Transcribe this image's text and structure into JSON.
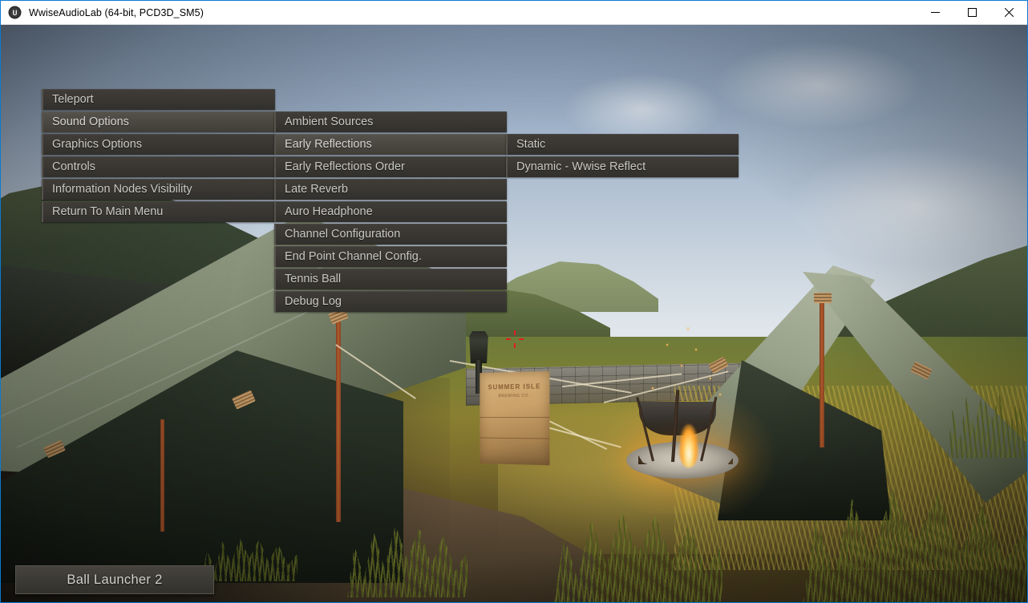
{
  "window": {
    "title": "WwiseAudioLab (64-bit, PCD3D_SM5)",
    "icon": "unreal-engine-icon",
    "controls": {
      "minimize": "minimize-icon",
      "maximize": "maximize-icon",
      "close": "close-icon"
    },
    "accent_border": "#0a7ad0"
  },
  "menus": {
    "column1": {
      "items": [
        {
          "label": "Teleport",
          "selected": false
        },
        {
          "label": "Sound Options",
          "selected": true
        },
        {
          "label": "Graphics Options",
          "selected": false
        },
        {
          "label": "Controls",
          "selected": false
        },
        {
          "label": "Information Nodes Visibility",
          "selected": false
        },
        {
          "label": "Return To Main Menu",
          "selected": false
        }
      ]
    },
    "column2": {
      "items": [
        {
          "label": "Ambient Sources",
          "selected": false
        },
        {
          "label": "Early Reflections",
          "selected": true
        },
        {
          "label": "Early Reflections Order",
          "selected": false
        },
        {
          "label": "Late Reverb",
          "selected": false
        },
        {
          "label": "Auro Headphone",
          "selected": false
        },
        {
          "label": "Channel Configuration",
          "selected": false
        },
        {
          "label": "End Point Channel Config.",
          "selected": false
        },
        {
          "label": "Tennis Ball",
          "selected": false
        },
        {
          "label": "Debug Log",
          "selected": false
        }
      ]
    },
    "column3": {
      "items": [
        {
          "label": "Static",
          "selected": false
        },
        {
          "label": "Dynamic - Wwise Reflect",
          "selected": false
        }
      ]
    }
  },
  "hud": {
    "active_object_label": "Ball Launcher 2",
    "crosshair": "crosshair-icon",
    "crosshair_color": "#e02020"
  },
  "scene": {
    "crate_label": "SUMMER ISLE",
    "crate_sublabel": "BREWING CO."
  }
}
